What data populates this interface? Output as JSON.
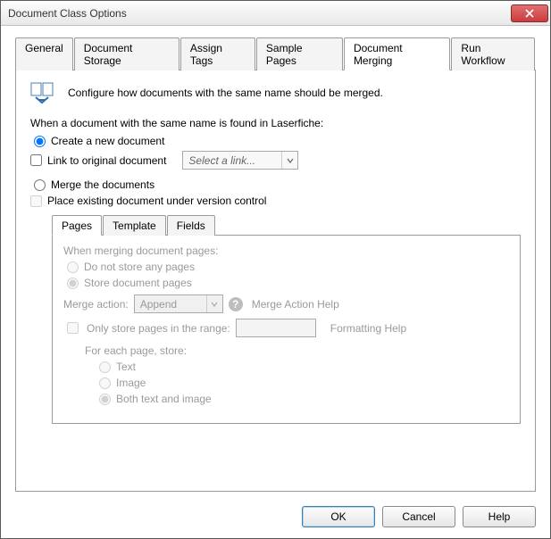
{
  "window": {
    "title": "Document Class Options"
  },
  "tabs": [
    "General",
    "Document Storage",
    "Assign Tags",
    "Sample Pages",
    "Document Merging",
    "Run Workflow"
  ],
  "active_tab": 4,
  "intro": "Configure how documents with the same name should be merged.",
  "section_heading": "When a document with the same name is found in Laserfiche:",
  "opt_create": {
    "label": "Create a new document",
    "selected": true
  },
  "link_original": {
    "label": "Link to original document",
    "placeholder": "Select a link..."
  },
  "opt_merge": {
    "label": "Merge the documents",
    "selected": false
  },
  "version_control": {
    "label": "Place existing document under version control"
  },
  "inner_tabs": [
    "Pages",
    "Template",
    "Fields"
  ],
  "inner_active": 0,
  "pages_panel": {
    "heading": "When merging document pages:",
    "no_store": "Do not store any pages",
    "store": "Store document pages",
    "merge_action_label": "Merge action:",
    "merge_action_value": "Append",
    "merge_help": "Merge Action Help",
    "only_range": "Only store pages in the range:",
    "format_help": "Formatting Help",
    "foreach": "For each page, store:",
    "r_text": "Text",
    "r_image": "Image",
    "r_both": "Both text and image"
  },
  "buttons": {
    "ok": "OK",
    "cancel": "Cancel",
    "help": "Help"
  }
}
